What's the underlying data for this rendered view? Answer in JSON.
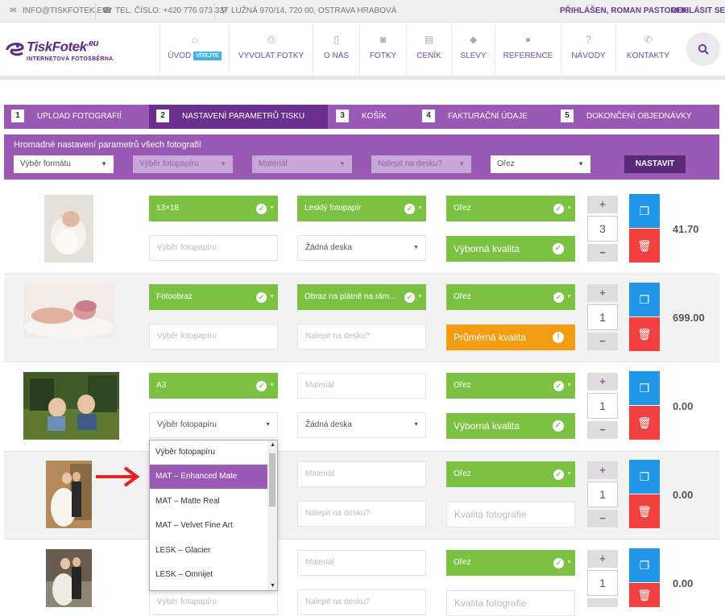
{
  "topbar": {
    "email": "INFO@TISKFOTEK.EU",
    "phone": "TEL. ČÍSLO: +420 776 073 337",
    "address": "LUŽNÁ 970/14, 720 00, OSTRAVA HRABOVÁ",
    "logged_in": "PŘIHLÁŠEN, ROMAN PASTOREK",
    "logout": "ODHLÁSIT SE"
  },
  "logo": {
    "name": "TiskFotek",
    "tld": ".eu",
    "sub1": "INTERNETOVÁ",
    "sub2": "FOTOSBĚRNA"
  },
  "nav": [
    {
      "label": "ÚVOD",
      "icon": "home-icon",
      "badge": "VÍTEJTE"
    },
    {
      "label": "VYVOLAT FOTKY",
      "icon": "printer-icon"
    },
    {
      "label": "O NÁS",
      "icon": "tablet-icon"
    },
    {
      "label": "FOTKY",
      "icon": "camera-icon"
    },
    {
      "label": "CENÍK",
      "icon": "table-icon"
    },
    {
      "label": "SLEVY",
      "icon": "tag-icon"
    },
    {
      "label": "REFERENCE",
      "icon": "comment-icon"
    },
    {
      "label": "NÁVODY",
      "icon": "question-icon"
    },
    {
      "label": "KONTAKTY",
      "icon": "phone-icon"
    }
  ],
  "steps": [
    {
      "num": "1",
      "label": "UPLOAD FOTOGRAFIÍ"
    },
    {
      "num": "2",
      "label": "NASTAVENÍ PARAMETRŮ TISKU"
    },
    {
      "num": "3",
      "label": "KOŠÍK"
    },
    {
      "num": "4",
      "label": "FAKTURAČNÍ ÚDAJE"
    },
    {
      "num": "5",
      "label": "DOKONČENÍ OBJEDNÁVKY"
    }
  ],
  "bulk": {
    "title": "Hromadné nastavení parametrů všech fotografií",
    "format": "Výběr formátu",
    "paper": "Výběr fotopapíru",
    "material": "Materiál",
    "board": "Nalepit na desku?",
    "crop": "Ořez",
    "button": "NASTAVIT"
  },
  "rows": [
    {
      "format": "13×18",
      "paper": "Výběr fotopapíru",
      "material": "Lesklý fotopapír",
      "board": "Žádná deska",
      "crop": "Ořez",
      "quality": "Výborná kvalita",
      "qty": "3",
      "price": "41.70"
    },
    {
      "format": "Fotoobraz",
      "paper": "Výběr fotopapíru",
      "material": "Obraz na plátně na rám...",
      "board": "Nalepit na desku?",
      "crop": "Ořez",
      "quality": "Průměrná kvalita",
      "qty": "1",
      "price": "699.00"
    },
    {
      "format": "A3",
      "paper": "Výběr fotopapíru",
      "material": "Materiál",
      "board": "Žádná deska",
      "crop": "Ořez",
      "quality": "Výborná kvalita",
      "qty": "1",
      "price": "0.00"
    },
    {
      "material": "Materiál",
      "board": "Nalepit na desku?",
      "crop": "Ořez",
      "quality": "Kvalita fotografie",
      "qty": "1",
      "price": "0.00"
    },
    {
      "paper": "Výběr fotopapíru",
      "material": "Materiál",
      "board": "Nalepit na desku?",
      "crop": "Ořez",
      "quality": "Kvalita fotografie",
      "qty": "1",
      "price": "0.00"
    }
  ],
  "dropdown": {
    "options": [
      "Výběr fotopapíru",
      "MAT – Enhanced Mate",
      "MAT – Matte Real",
      "MAT – Velvet Fine Art",
      "LESK – Glacier",
      "LESK – Omnijet"
    ],
    "selected_index": 1
  },
  "colors": {
    "purple": "#9b59b6",
    "green": "#7cc242",
    "blue": "#2196e8",
    "red": "#f04040",
    "orange": "#f39c12",
    "arrow": "#e8201f"
  }
}
